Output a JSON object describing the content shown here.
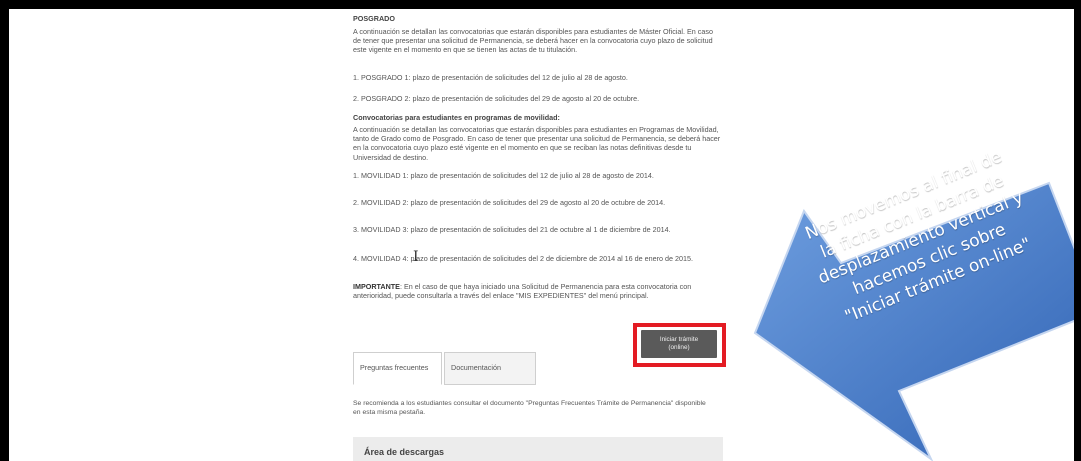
{
  "section_posgrado": {
    "heading": "POSGRADO",
    "intro": "A continuación se detallan las convocatorias que estarán disponibles para estudiantes de Máster Oficial. En caso de tener que presentar una solicitud de Permanencia, se deberá hacer en la convocatoria cuyo plazo de solicitud este vigente en el momento en que se tienen las actas de tu titulación.",
    "items": [
      "1. POSGRADO 1: plazo de presentación de solicitudes del 12 de julio al 28 de agosto.",
      "2. POSGRADO 2: plazo de presentación de solicitudes del 29 de agosto al 20 de octubre."
    ]
  },
  "section_movilidad": {
    "heading": "Convocatorias para estudiantes en programas de movilidad:",
    "intro": "A continuación se detallan las convocatorias que estarán disponibles para estudiantes en Programas de Movilidad, tanto de Grado como de Posgrado. En caso de tener que presentar una solicitud de Permanencia, se deberá hacer en la convocatoria cuyo plazo esté vigente en el momento en que se reciban las notas definitivas desde tu Universidad de destino.",
    "items": [
      "1. MOVILIDAD 1: plazo de presentación de solicitudes del 12 de julio al 28 de agosto de 2014.",
      "2. MOVILIDAD 2: plazo de presentación de solicitudes del 29 de agosto al 20 de octubre de 2014.",
      "3. MOVILIDAD 3: plazo de presentación de solicitudes del 21 de octubre al 1 de diciembre de 2014.",
      "4. MOVILIDAD 4: plazo de presentación de solicitudes del 2 de diciembre de 2014 al 16 de enero de 2015."
    ]
  },
  "important": {
    "label": "IMPORTANTE",
    "text": ": En el caso de que haya iniciado una Solicitud de Permanencia para esta convocatoria con anterioridad, puede consultarla a través del enlace \"MIS EXPEDIENTES\" del menú principal."
  },
  "start_button": {
    "line1": "Iniciar trámite",
    "line2": "(online)"
  },
  "tabs": [
    {
      "label": "Preguntas frecuentes"
    },
    {
      "label": "Documentación"
    }
  ],
  "tab_panel_text": "Se recomienda a los estudiantes consultar el documento \"Preguntas Frecuentes Trámite de Permanencia\" disponible en esta  misma pestaña.",
  "downloads_title": "Área de descargas",
  "callout": {
    "lines": [
      "Nos movemos al final de",
      "la ficha con la barra de",
      "desplazamiento vertical y",
      "hacemos clic sobre",
      "\"Iniciar trámite on-line\""
    ],
    "color_light": "#5b8fd6",
    "color_dark": "#2e5fae"
  },
  "highlight_color": "#e31b23"
}
